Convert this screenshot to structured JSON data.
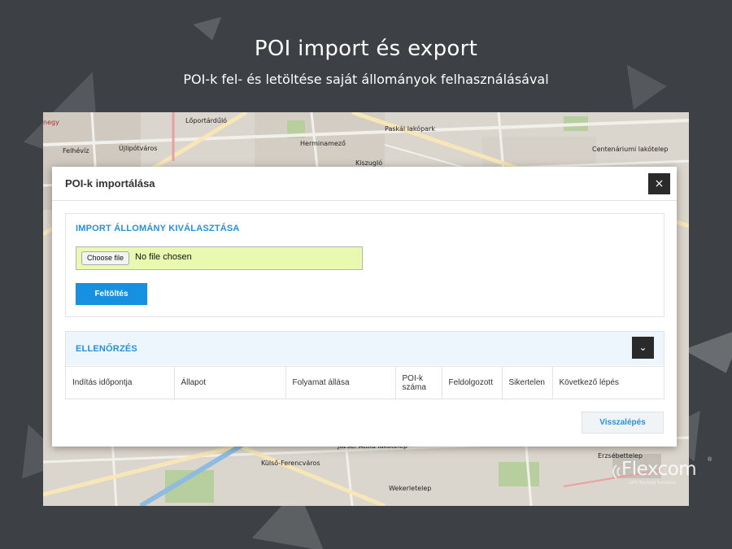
{
  "header": {
    "title": "POI import és export",
    "subtitle": "POI-k fel- és letöltése saját állományok felhasználásával"
  },
  "map": {
    "labels": [
      "Lőportárdűló",
      "Paskál lakópark",
      "Herminamező",
      "Centenáriumi lakótelep",
      "Újlipótváros",
      "Felhévíz",
      "Kiszugló",
      "Külső-Ferencváros",
      "Wekerletelep",
      "Erzsébettelep",
      "József Attila lakótelep",
      "negy"
    ]
  },
  "modal": {
    "title": "POI-k importálása",
    "close_label": "×",
    "import_section": {
      "title": "IMPORT ÁLLOMÁNY KIVÁLASZTÁSA",
      "file_button_label": "Choose file",
      "file_status": "No file chosen",
      "upload_button_label": "Feltöltés"
    },
    "check_section": {
      "title": "ELLENŐRZÉS",
      "toggle_icon": "⌄",
      "columns": [
        "Indítás időpontja",
        "Állapot",
        "Folyamat állása",
        "POI-k száma",
        "Feldolgozott",
        "Sikertelen",
        "Következő lépés"
      ]
    },
    "back_button_label": "Visszalépés"
  },
  "brand": {
    "name": "Flexcom",
    "registered": "®",
    "tagline": "GPS Tracking Solutions",
    "icon": "signal-waves-icon"
  },
  "colors": {
    "background": "#3d4044",
    "accent": "#1691e2",
    "file_input_bg": "#e9fab0"
  }
}
